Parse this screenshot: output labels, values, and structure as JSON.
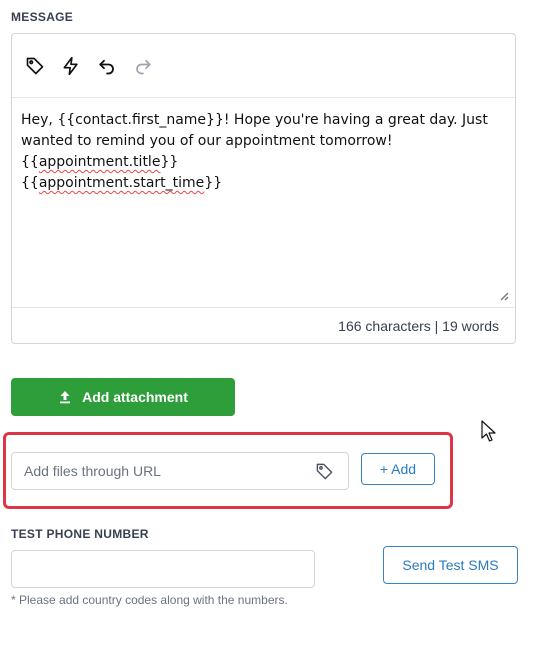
{
  "message": {
    "label": "MESSAGE",
    "toolbar": {
      "icons": [
        "tag-icon",
        "lightning-icon",
        "undo-icon",
        "redo-icon"
      ]
    },
    "body": {
      "line1": "Hey, {{contact.first_name}}! Hope you're having a great day. Just wanted to remind you of our appointment tomorrow!",
      "line2_open": "{{",
      "line2_var": "appointment.title",
      "line2_close": "}}",
      "line3_open": "{{",
      "line3_var": "appointment.start_time",
      "line3_close": "}}"
    },
    "counter": "166 characters | 19 words"
  },
  "attachment": {
    "button_label": "Add attachment",
    "icon": "upload-icon"
  },
  "url_upload": {
    "placeholder": "Add files through URL",
    "add_label": "+ Add",
    "highlight_color": "#dc3545"
  },
  "test_phone": {
    "label": "TEST PHONE NUMBER",
    "value": "",
    "hint": "* Please add country codes along with the numbers.",
    "send_label": "Send Test SMS"
  },
  "colors": {
    "primary_green": "#2e9e3b",
    "link_blue": "#2b7bbf",
    "border": "#d1d5db"
  }
}
